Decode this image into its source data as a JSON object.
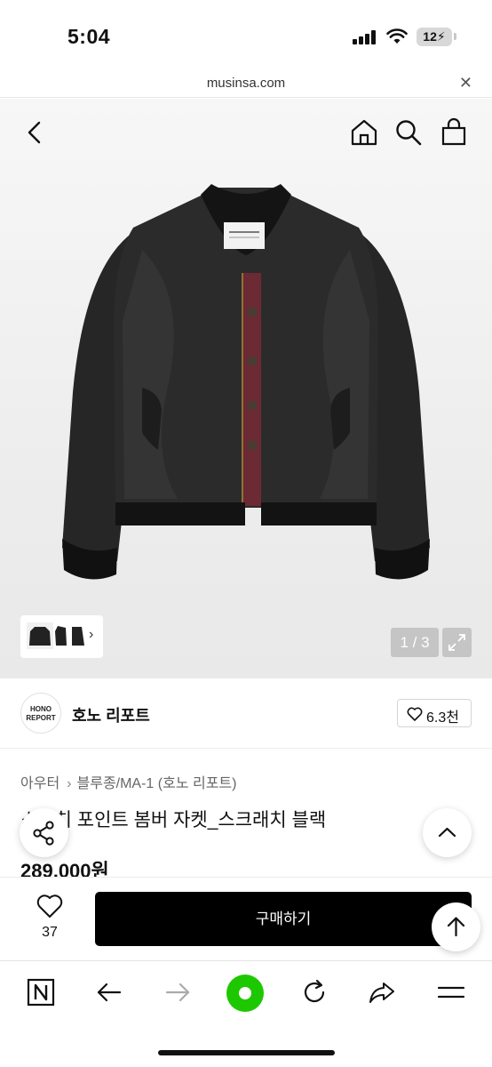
{
  "status": {
    "time": "5:04",
    "battery": "12"
  },
  "browser": {
    "url": "musinsa.com",
    "close_icon": "close-icon"
  },
  "gallery": {
    "counter": "1 / 3",
    "thumb_arrow": "›"
  },
  "brand": {
    "logo_line1": "HONO",
    "logo_line2": "REPORT",
    "name": "호노 리포트",
    "likes": "6.3천"
  },
  "product": {
    "breadcrumb": [
      "아우터",
      "블루종/MA-1 (호노 리포트)"
    ],
    "breadcrumb_sep": "›",
    "title": "스티치 포인트 봄버 자켓_스크래치 블랙",
    "price": "289,000원"
  },
  "purchase": {
    "wish_count": "37",
    "buy_label": "구매하기"
  },
  "colors": {
    "accent_green": "#1ec800",
    "buy_button": "#000000"
  }
}
